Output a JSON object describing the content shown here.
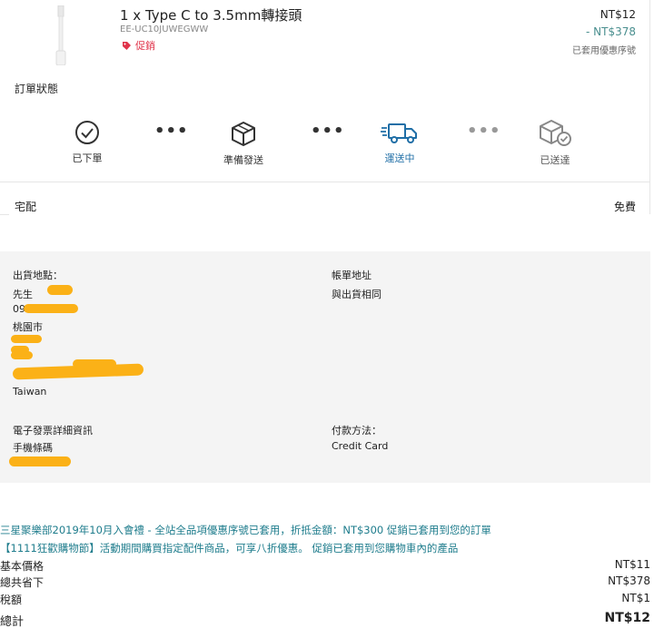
{
  "product": {
    "name": "1 x Type C to 3.5mm轉接頭",
    "sku": "EE-UC10JUWEGWW",
    "promo_tag": "促銷",
    "price": "NT$12",
    "discount": "- NT$378",
    "coupon_note": "已套用優惠序號"
  },
  "order_status": {
    "title": "訂單狀態",
    "steps": [
      {
        "label": "已下單",
        "icon": "check-circle-icon",
        "active": false
      },
      {
        "label": "準備發送",
        "icon": "box-icon",
        "active": false
      },
      {
        "label": "運送中",
        "icon": "truck-icon",
        "active": true
      },
      {
        "label": "已送達",
        "icon": "delivered-box-icon",
        "active": false
      }
    ],
    "separator": "..."
  },
  "shipping": {
    "method": "宅配",
    "fee": "免費"
  },
  "address": {
    "ship_from_label": "出貨地點：",
    "name_prefix": "先生",
    "phone_prefix": "09",
    "city": "桃園市",
    "country": "Taiwan",
    "billing_label": "帳單地址",
    "billing_value": "與出貨相同",
    "invoice_label": "電子發票詳細資訊",
    "invoice_type": "手機條碼",
    "payment_label": "付款方法：",
    "payment_value": "Credit Card"
  },
  "promotions": [
    "三星聚樂部2019年10月入會禮 - 全站全品項優惠序號已套用，折抵金額：NT$300 促銷已套用到您的訂單",
    "【1111狂歡購物節】活動期間購買指定配件商品，可享八折優惠。 促銷已套用到您購物車內的產品"
  ],
  "summary": {
    "base_label": "基本價格",
    "base_value": "NT$11",
    "saved_label": "總共省下",
    "saved_value": "NT$378",
    "tax_label": "稅額",
    "tax_value": "NT$1",
    "total_label": "總計",
    "total_value": "NT$12"
  },
  "colors": {
    "accent_blue": "#1f6ea6",
    "promo_teal": "#1e7c8c",
    "promo_red": "#e0334a",
    "redaction": "#fbb117"
  }
}
